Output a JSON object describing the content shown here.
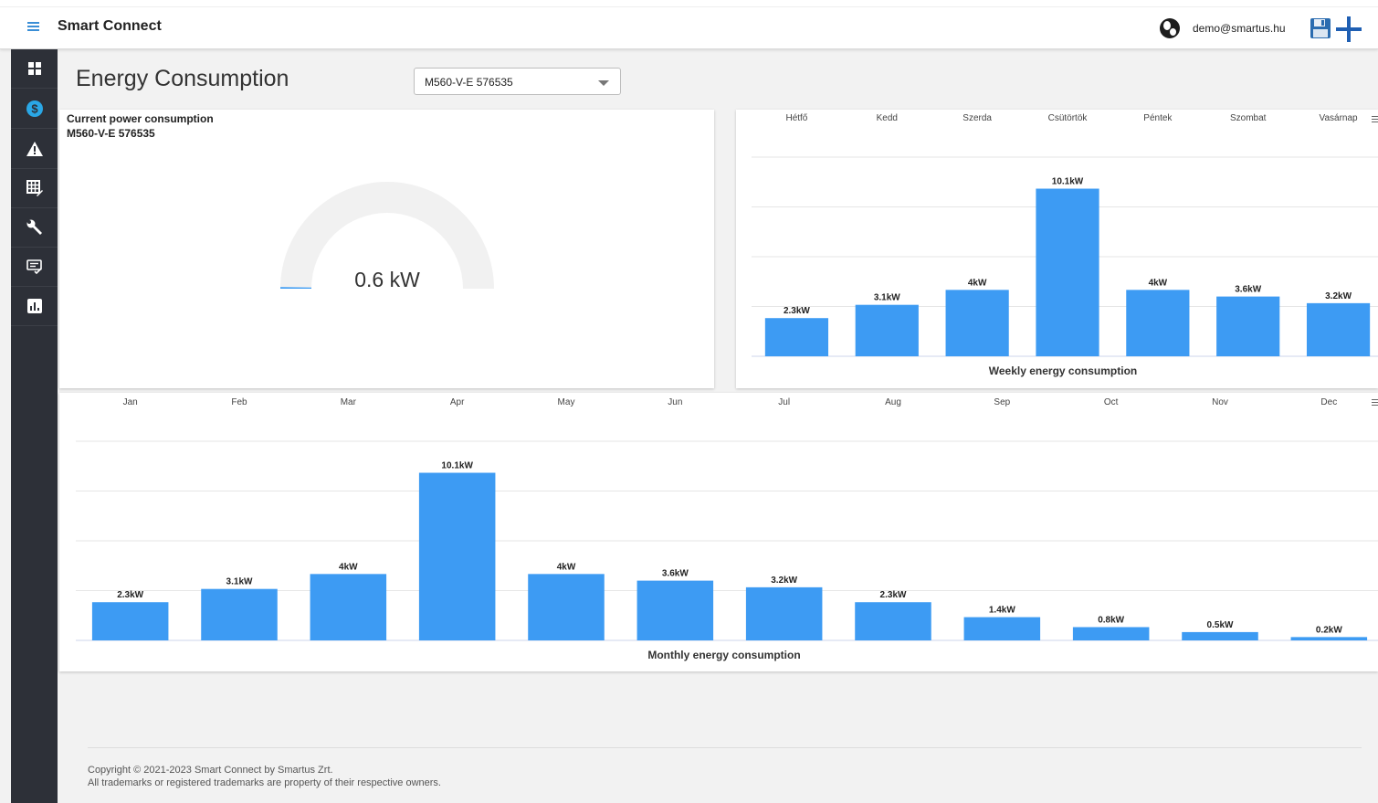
{
  "app": {
    "title": "Smart Connect",
    "user_email": "demo@smartus.hu"
  },
  "sidebar": {
    "items": [
      {
        "name": "dashboard",
        "icon": "dashboard-icon",
        "active": false
      },
      {
        "name": "billing",
        "icon": "dollar-icon",
        "active": true
      },
      {
        "name": "alerts",
        "icon": "warning-icon",
        "active": false
      },
      {
        "name": "grid-edit",
        "icon": "grid-edit-icon",
        "active": false
      },
      {
        "name": "maintenance",
        "icon": "wrench-icon",
        "active": false
      },
      {
        "name": "reports",
        "icon": "list-check-icon",
        "active": false
      },
      {
        "name": "analytics",
        "icon": "bar-chart-icon",
        "active": true
      }
    ]
  },
  "page": {
    "title": "Energy Consumption",
    "device_select": "M560-V-E 576535"
  },
  "gauge": {
    "title": "Current power consumption",
    "device": "M560-V-E 576535",
    "value": 0.6,
    "value_label": "0.6 kW"
  },
  "colors": {
    "bar": "#3d9bf3",
    "accent": "#3a8ed6",
    "sidebar_bg": "#2d3038",
    "sidebar_active": "#2aa7e6"
  },
  "chart_data": [
    {
      "type": "bar",
      "title": "Weekly energy consumption",
      "categories": [
        "Hétfő",
        "Kedd",
        "Szerda",
        "Csütörtök",
        "Péntek",
        "Szombat",
        "Vasárnap"
      ],
      "values": [
        2.3,
        3.1,
        4,
        10.1,
        4,
        3.6,
        3.2
      ],
      "labels": [
        "2.3kW",
        "3.1kW",
        "4kW",
        "10.1kW",
        "4kW",
        "3.6kW",
        "3.2kW"
      ],
      "ylim": [
        0,
        12
      ],
      "grid": true,
      "category_position": "top"
    },
    {
      "type": "bar",
      "title": "Monthly energy consumption",
      "categories": [
        "Jan",
        "Feb",
        "Mar",
        "Apr",
        "May",
        "Jun",
        "Jul",
        "Aug",
        "Sep",
        "Oct",
        "Nov",
        "Dec"
      ],
      "values": [
        2.3,
        3.1,
        4,
        10.1,
        4,
        3.6,
        3.2,
        2.3,
        1.4,
        0.8,
        0.5,
        0.2
      ],
      "labels": [
        "2.3kW",
        "3.1kW",
        "4kW",
        "10.1kW",
        "4kW",
        "3.6kW",
        "3.2kW",
        "2.3kW",
        "1.4kW",
        "0.8kW",
        "0.5kW",
        "0.2kW"
      ],
      "ylim": [
        0,
        12
      ],
      "grid": true,
      "category_position": "top"
    }
  ],
  "footer": {
    "copyright": "Copyright © 2021-2023 Smart Connect by Smartus Zrt.",
    "trademark": "All trademarks or registered trademarks are property of their respective owners."
  }
}
